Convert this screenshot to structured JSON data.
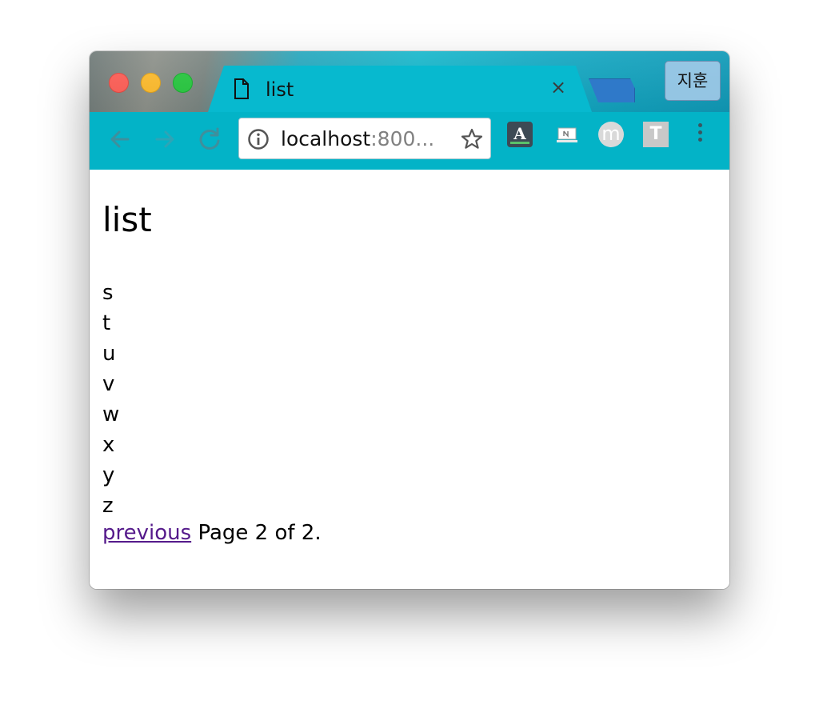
{
  "browser": {
    "tab": {
      "title": "list",
      "close_glyph": "×"
    },
    "profile_label": "지훈",
    "omnibox": {
      "host": "localhost",
      "rest": ":800..."
    },
    "extensions": {
      "dict_letter": "A",
      "m_letter": "m",
      "t_letter": "T"
    },
    "icons": [
      "file-icon",
      "close-icon",
      "back-icon",
      "forward-icon",
      "reload-icon",
      "info-icon",
      "star-icon",
      "dictionary-extension-icon",
      "note-extension-icon",
      "m-extension-icon",
      "t-extension-icon",
      "menu-icon"
    ]
  },
  "page": {
    "title": "list",
    "items": [
      "s",
      "t",
      "u",
      "v",
      "w",
      "x",
      "y",
      "z"
    ],
    "pagination": {
      "previous_label": "previous",
      "status": "Page 2 of 2."
    }
  },
  "colors": {
    "link_visited": "#551a8b",
    "chrome_teal": "#03b3c7",
    "new_tab_blue": "#2f79c9"
  }
}
